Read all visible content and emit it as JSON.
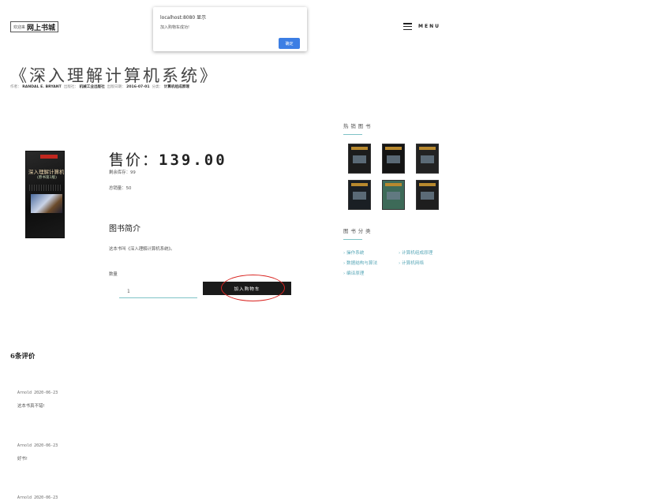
{
  "header": {
    "logo_small": "欢迎来",
    "logo_big": "网上书城",
    "menu_label": "MENU"
  },
  "dialog": {
    "title": "localhost:8080 显示",
    "message": "加入购物车成功!",
    "ok_label": "确定"
  },
  "book": {
    "title": "《深入理解计算机系统》",
    "meta": {
      "author_label": "作者",
      "author": "RANDAL E. BRYANT",
      "publisher_label": "出版社",
      "publisher": "机械工业出版社",
      "date_label": "出版日期",
      "date": "2016-07-01",
      "category_label": "分类",
      "category": "计算机组成原理"
    },
    "cover": {
      "title": "深入理解计算机系统",
      "subtitle": "(原书第3版)"
    },
    "price_label": "售价：",
    "price": "139.00",
    "stock_text": "剩余库存：99",
    "sold_text": "总销量：50",
    "intro_heading": "图书简介",
    "intro_text": "这本书叫《深入理解计算机系统》。",
    "quantity_label": "数量",
    "quantity_value": "1",
    "add_to_cart_label": "加入购物车"
  },
  "sidebar": {
    "hot_heading": "热销图书",
    "hot_books": [
      {
        "name": "hot-book-1",
        "color": "#1c1c1c"
      },
      {
        "name": "hot-book-2",
        "color": "#141414"
      },
      {
        "name": "hot-book-3",
        "color": "#222222"
      },
      {
        "name": "hot-book-4",
        "color": "#1a1f24"
      },
      {
        "name": "hot-book-5",
        "color": "#3d6a58"
      },
      {
        "name": "hot-book-6",
        "color": "#1e1e1e"
      }
    ],
    "category_heading": "图书分类",
    "categories": [
      "› 操作系统",
      "› 计算机组成原理",
      "› 数据结构与算法",
      "› 计算机网络",
      "› 编译原理"
    ]
  },
  "reviews": {
    "heading": "6条评价",
    "items": [
      {
        "user_date": "Arnold 2020-06-23",
        "text": "这本书真不错!"
      },
      {
        "user_date": "Arnold 2020-06-23",
        "text": "好书!"
      },
      {
        "user_date": "Arnold 2020-06-23",
        "text": ""
      }
    ]
  }
}
